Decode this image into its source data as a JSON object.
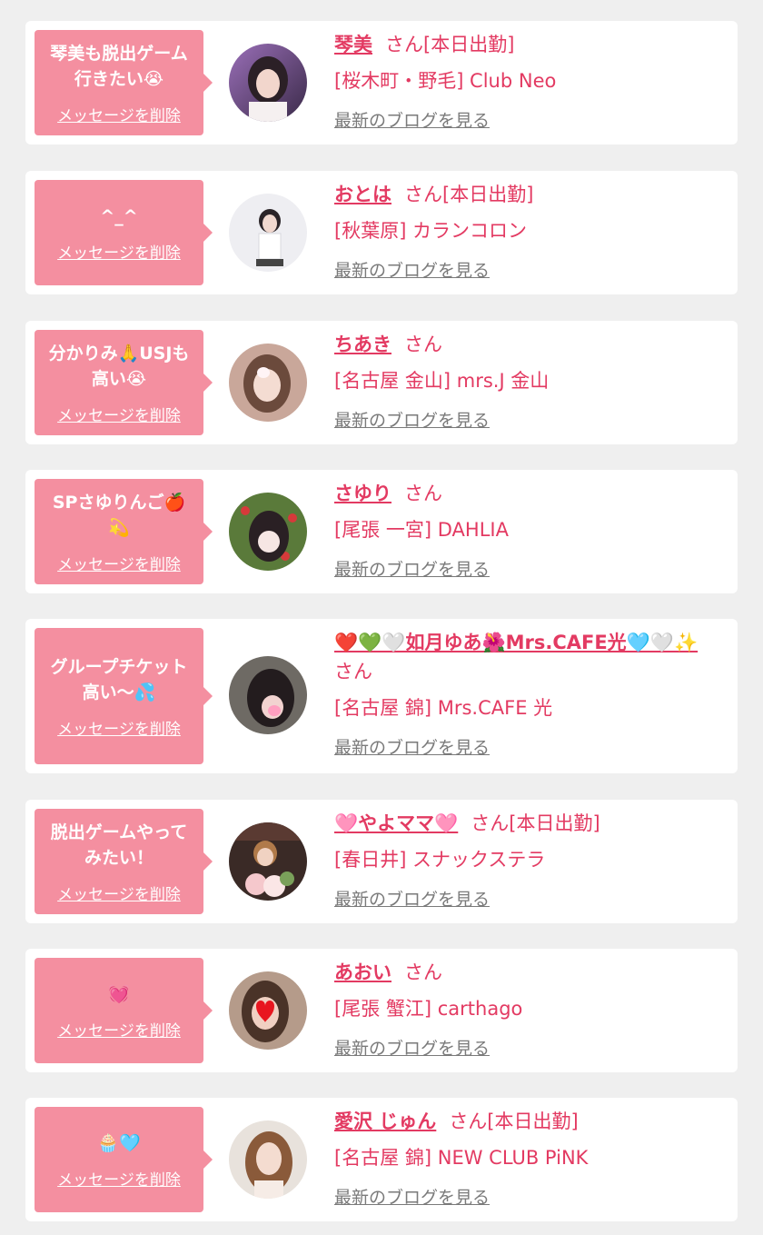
{
  "delete_label": "メッセージを削除",
  "blog_label": "最新のブログを見る",
  "colors": {
    "accent": "#e33a62",
    "bubble": "#f48fa0",
    "background": "#efefef",
    "card": "#ffffff"
  },
  "cards": [
    {
      "message": "琴美も脱出ゲーム\n行きたい😭",
      "name": "琴美",
      "suffix": "さん[本日出勤]",
      "shop": "[桜木町・野毛] Club Neo"
    },
    {
      "message": "^_^",
      "name": "おとは",
      "suffix": "さん[本日出勤]",
      "shop": "[秋葉原] カランコロン"
    },
    {
      "message": "分かりみ🙏USJも\n高い😭",
      "name": "ちあき",
      "suffix": "さん",
      "shop": "[名古屋 金山] mrs.J 金山"
    },
    {
      "message": "SPさゆりんご🍎\n💫",
      "name": "さゆり",
      "suffix": "さん",
      "shop": "[尾張 一宮] DAHLIA"
    },
    {
      "message": "グループチケット\n高い〜💦",
      "name": "❤️💚🤍如月ゆあ🌺Mrs.CAFE光🩵🤍✨",
      "suffix": "さん",
      "shop": "[名古屋 錦] Mrs.CAFE 光"
    },
    {
      "message": "脱出ゲームやって\nみたい！",
      "name": "🩷やよママ🩷",
      "suffix": "さん[本日出勤]",
      "shop": "[春日井] スナックステラ"
    },
    {
      "message": "💓",
      "name": "あおい",
      "suffix": "さん",
      "shop": "[尾張 蟹江] carthago"
    },
    {
      "message": "🧁🩵",
      "name": "愛沢 じゅん",
      "suffix": "さん[本日出勤]",
      "shop": "[名古屋 錦] NEW CLUB PiNK"
    }
  ]
}
